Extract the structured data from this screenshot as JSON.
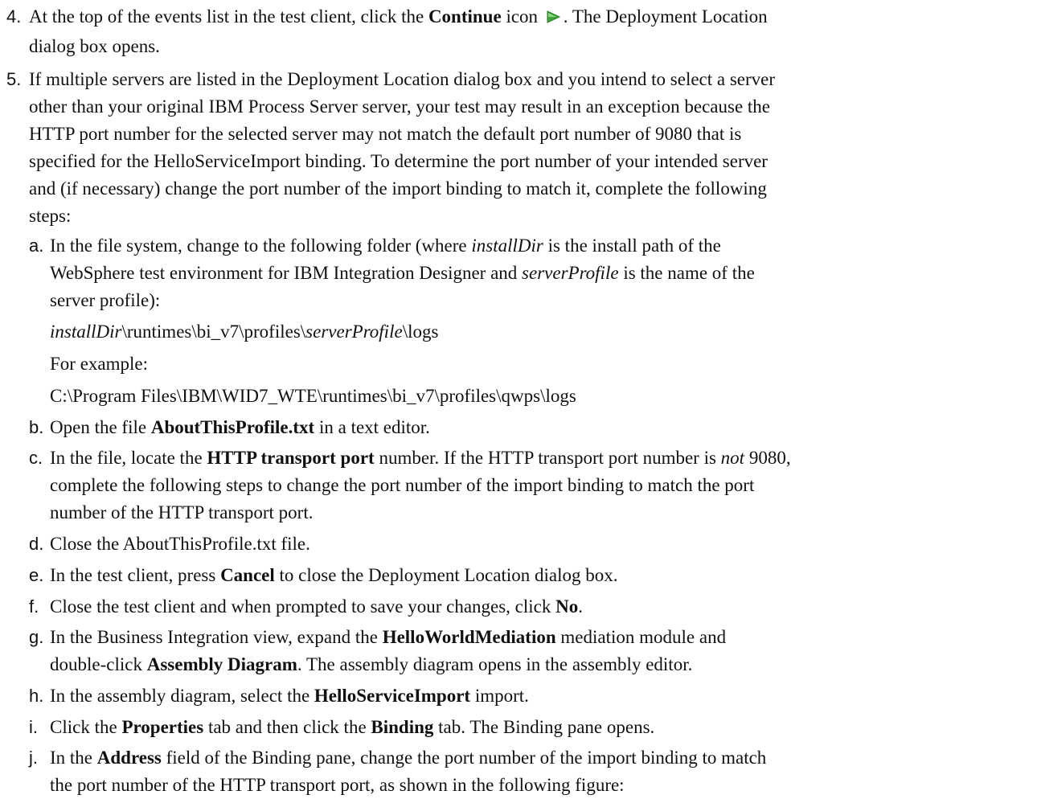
{
  "steps": [
    {
      "number": "4.",
      "lines": [
        [
          "At the top of the events list in the test client, click the ",
          {
            "b": "Continue"
          },
          " icon ",
          {
            "icon": "continue-icon"
          },
          ". The Deployment Location"
        ],
        [
          "dialog box opens."
        ]
      ]
    },
    {
      "number": "5.",
      "lines": [
        [
          "If multiple servers are listed in the Deployment Location dialog box and you intend to select a server"
        ],
        [
          "other than your original IBM Process Server server, your test may result in an exception because the"
        ],
        [
          "HTTP port number for the selected server may not match the default port number of 9080 that is"
        ],
        [
          "specified for the HelloServiceImport binding. To determine the port number of your intended server"
        ],
        [
          "and (if necessary) change the port number of the import binding to match it, complete the following"
        ],
        [
          "steps:"
        ]
      ]
    }
  ],
  "substeps": [
    {
      "letter": "a.",
      "lines": [
        [
          "In the file system, change to the following folder (where ",
          {
            "i": "installDir"
          },
          " is the install path of the"
        ],
        [
          "WebSphere test environment for IBM Integration Designer and ",
          {
            "i": "serverProfile"
          },
          " is the name of the"
        ],
        [
          "server profile):"
        ]
      ],
      "extra": [
        [
          {
            "i": "installDir"
          },
          "\\runtimes\\bi_v7\\profiles\\",
          {
            "i": "serverProfile"
          },
          "\\logs"
        ],
        [
          "For example:"
        ],
        [
          "C:\\Program Files\\IBM\\WID7_WTE\\runtimes\\bi_v7\\profiles\\qwps\\logs"
        ]
      ]
    },
    {
      "letter": "b.",
      "lines": [
        [
          "Open the file ",
          {
            "b": "AboutThisProfile.txt"
          },
          " in a text editor."
        ]
      ]
    },
    {
      "letter": "c.",
      "lines": [
        [
          "In the file, locate the ",
          {
            "b": "HTTP transport port"
          },
          " number. If the HTTP transport port number is ",
          {
            "i": "not"
          },
          " 9080,"
        ],
        [
          "complete the following steps to change the port number of the import binding to match the port"
        ],
        [
          "number of the HTTP transport port."
        ]
      ]
    },
    {
      "letter": "d.",
      "lines": [
        [
          "Close the AboutThisProfile.txt file."
        ]
      ]
    },
    {
      "letter": "e.",
      "lines": [
        [
          "In the test client, press ",
          {
            "b": "Cancel"
          },
          " to close the Deployment Location dialog box."
        ]
      ]
    },
    {
      "letter": "f.",
      "lines": [
        [
          "Close the test client and when prompted to save your changes, click ",
          {
            "b": "No"
          },
          "."
        ]
      ]
    },
    {
      "letter": "g.",
      "lines": [
        [
          "In the Business Integration view, expand the ",
          {
            "b": "HelloWorldMediation"
          },
          " mediation module and"
        ],
        [
          "double-click ",
          {
            "b": "Assembly Diagram"
          },
          ". The assembly diagram opens in the assembly editor."
        ]
      ]
    },
    {
      "letter": "h.",
      "lines": [
        [
          "In the assembly diagram, select the ",
          {
            "b": "HelloServiceImport"
          },
          " import."
        ]
      ]
    },
    {
      "letter": "i.",
      "lines": [
        [
          "Click the ",
          {
            "b": "Properties"
          },
          " tab and then click the ",
          {
            "b": "Binding"
          },
          " tab. The Binding pane opens."
        ]
      ]
    },
    {
      "letter": "j.",
      "lines": [
        [
          "In the ",
          {
            "b": "Address"
          },
          " field of the Binding pane, change the port number of the import binding to match"
        ],
        [
          "the port number of the HTTP transport port, as shown in the following figure:"
        ]
      ]
    }
  ],
  "colors": {
    "text": "#111111",
    "icon_green": "#3fa53a"
  }
}
